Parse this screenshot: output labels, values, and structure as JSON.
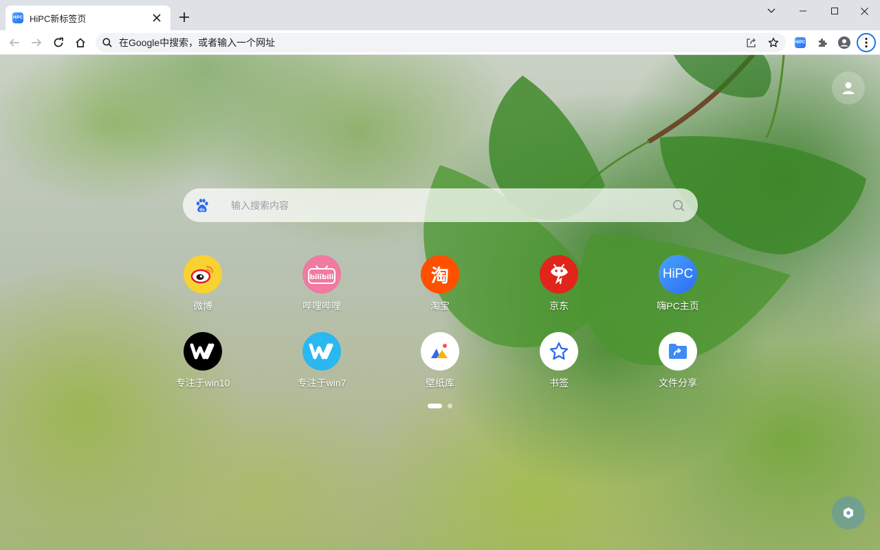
{
  "browser": {
    "tab": {
      "title": "HiPC新标签页",
      "favicon_text": "HiPC"
    },
    "omnibox": {
      "placeholder": "在Google中搜索，或者输入一个网址"
    },
    "extension": {
      "badge_text": "HiPC"
    }
  },
  "page": {
    "search": {
      "placeholder": "输入搜索内容",
      "engine_icon": "baidu-paw-icon"
    },
    "shortcuts": [
      {
        "label": "微博",
        "icon": "weibo-icon",
        "color": "#f8d231"
      },
      {
        "label": "哔哩哔哩",
        "icon": "bilibili-icon",
        "color": "#f07aa0",
        "icon_text": "bilibili"
      },
      {
        "label": "淘宝",
        "icon": "taobao-icon",
        "color": "#ff5000",
        "icon_text": "淘"
      },
      {
        "label": "京东",
        "icon": "jd-icon",
        "color": "#e1251b"
      },
      {
        "label": "嗨PC主页",
        "icon": "hipc-icon",
        "color": "#3a86ff",
        "icon_text": "HiPC"
      },
      {
        "label": "专注于win10",
        "icon": "win10-icon",
        "color": "#000000"
      },
      {
        "label": "专注于win7",
        "icon": "win7-icon",
        "color": "#2bb7f0"
      },
      {
        "label": "壁纸库",
        "icon": "wallpaper-icon",
        "color": "#ffffff"
      },
      {
        "label": "书签",
        "icon": "bookmark-star-icon",
        "color": "#ffffff"
      },
      {
        "label": "文件分享",
        "icon": "file-share-icon",
        "color": "#ffffff"
      }
    ],
    "pager": {
      "pages": 2,
      "active": 1
    }
  }
}
